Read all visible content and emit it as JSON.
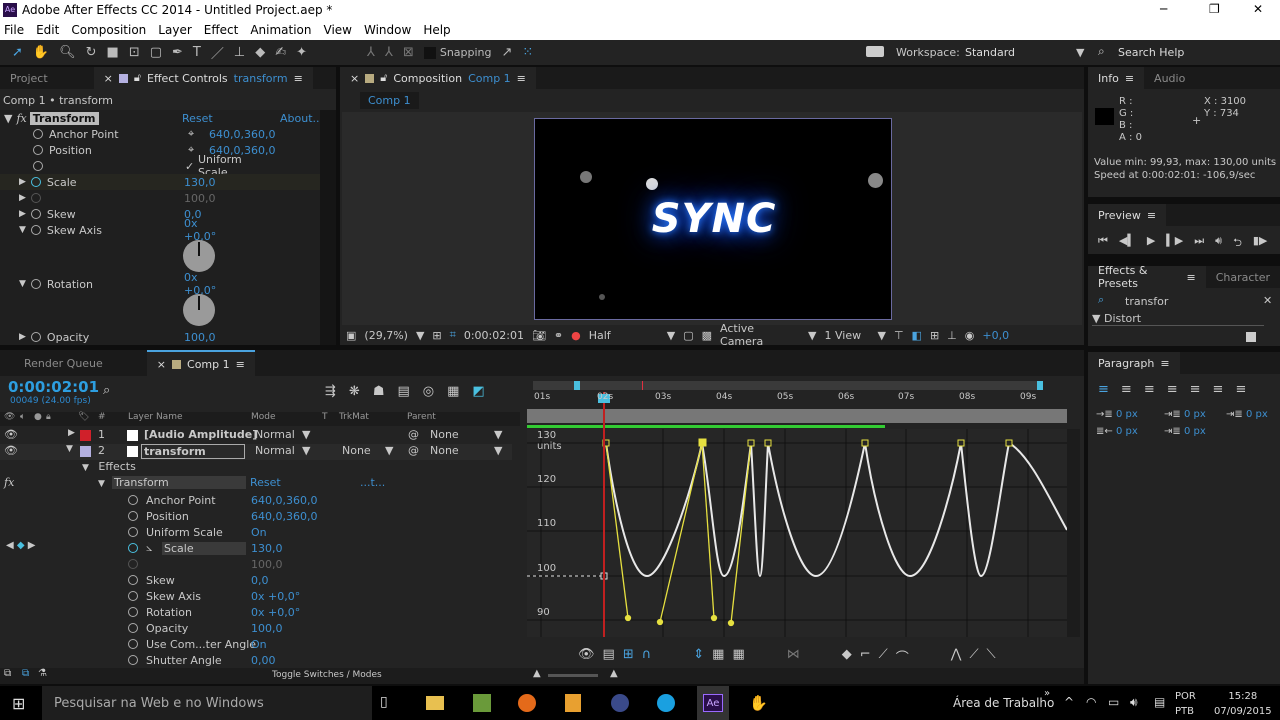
{
  "window": {
    "title": "Adobe After Effects CC 2014 - Untitled Project.aep *",
    "app_icon": "Ae",
    "minimize": "─",
    "maximize": "❐",
    "close": "✕"
  },
  "menu": [
    "File",
    "Edit",
    "Composition",
    "Layer",
    "Effect",
    "Animation",
    "View",
    "Window",
    "Help"
  ],
  "toolbar": {
    "snapping": "Snapping",
    "workspace_label": "Workspace:",
    "workspace": "Standard",
    "search_help": "Search Help"
  },
  "left_panel": {
    "tab_project": "Project",
    "tab_effect_controls": "Effect Controls",
    "tab_effect_target": "transform",
    "breadcrumb": "Comp 1 • transform",
    "effect_name": "Transform",
    "reset": "Reset",
    "about": "About...",
    "props": [
      {
        "name": "Anchor Point",
        "value": "640,0,360,0"
      },
      {
        "name": "Position",
        "value": "640,0,360,0"
      },
      {
        "name": "",
        "value": "Uniform Scale"
      },
      {
        "name": "Scale",
        "value": "130,0"
      },
      {
        "name": "",
        "value": "100,0"
      },
      {
        "name": "Skew",
        "value": "0,0"
      },
      {
        "name": "Skew Axis",
        "value": "0x +0,0°"
      },
      {
        "name": "Rotation",
        "value": "0x +0,0°"
      },
      {
        "name": "Opacity",
        "value": "100,0"
      }
    ]
  },
  "composition": {
    "tab_label": "Composition",
    "tab_comp": "Comp 1",
    "sub_tab": "Comp 1",
    "title_text": "SYNC",
    "zoom": "(29,7%)",
    "timecode": "0:00:02:01",
    "resolution": "Half",
    "camera": "Active Camera",
    "views": "1 View",
    "exposure": "+0,0"
  },
  "info": {
    "tab": "Info",
    "tab_audio": "Audio",
    "r": "R :",
    "g": "G :",
    "b": "B :",
    "a": "A : 0",
    "x": "X : 3100",
    "y": "Y : 734",
    "value_line": "Value min: 99,93, max: 130,00 units",
    "speed_line": "Speed at 0:00:02:01: -106,9/sec"
  },
  "preview": {
    "tab": "Preview"
  },
  "effects_presets": {
    "tab": "Effects & Presets",
    "tab_character": "Character",
    "search": "transfor",
    "category": "Distort"
  },
  "paragraph": {
    "tab": "Paragraph",
    "indents": [
      "0 px",
      "0 px",
      "0 px",
      "0 px",
      "0 px"
    ]
  },
  "timeline": {
    "tab_render": "Render Queue",
    "tab_comp": "Comp 1",
    "timecode": "0:00:02:01",
    "frames": "00049 (24.00 fps)",
    "headers": {
      "num": "#",
      "layer_name": "Layer Name",
      "mode": "Mode",
      "t": "T",
      "trkmat": "TrkMat",
      "parent": "Parent"
    },
    "layers": [
      {
        "num": "1",
        "name": "[Audio Amplitude]",
        "mode": "Normal",
        "trkmat": "",
        "parent": "None",
        "color": "#d0202a"
      },
      {
        "num": "2",
        "name": "transform",
        "mode": "Normal",
        "trkmat": "None",
        "parent": "None",
        "color": "#b4b0e0"
      }
    ],
    "effects_label": "Effects",
    "effect_name": "Transform",
    "reset": "Reset",
    "about": "...t...",
    "props": [
      {
        "name": "Anchor Point",
        "value": "640,0,360,0"
      },
      {
        "name": "Position",
        "value": "640,0,360,0"
      },
      {
        "name": "Uniform Scale",
        "value": "On"
      },
      {
        "name": "Scale",
        "value": "130,0"
      },
      {
        "name": "",
        "value": "100,0"
      },
      {
        "name": "Skew",
        "value": "0,0"
      },
      {
        "name": "Skew Axis",
        "value": "0x +0,0°"
      },
      {
        "name": "Rotation",
        "value": "0x +0,0°"
      },
      {
        "name": "Opacity",
        "value": "100,0"
      },
      {
        "name": "Use Com...ter Angle",
        "value": "On"
      },
      {
        "name": "Shutter Angle",
        "value": "0,00"
      }
    ],
    "toggle": "Toggle Switches / Modes",
    "ruler": [
      "01s",
      "02s",
      "03s",
      "04s",
      "05s",
      "06s",
      "07s",
      "08s",
      "09s"
    ],
    "graph_labels": [
      "130 units",
      "120",
      "110",
      "100",
      "90"
    ]
  },
  "taskbar": {
    "search": "Pesquisar na Web e no Windows",
    "desktop": "Área de Trabalho",
    "lang1": "POR",
    "lang2": "PTB",
    "time": "15:28",
    "date": "07/09/2015"
  }
}
